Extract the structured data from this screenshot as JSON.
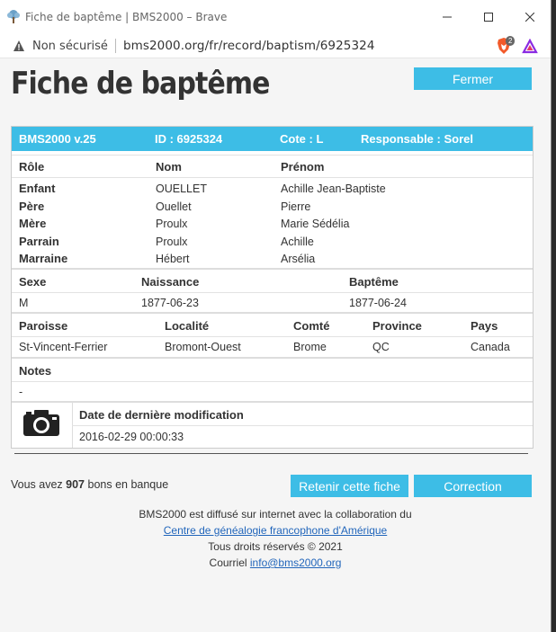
{
  "window": {
    "title": "Fiche de baptême | BMS2000 – Brave",
    "security_label": "Non sécurisé",
    "url": "bms2000.org/fr/record/baptism/6925324",
    "shield_count": "2"
  },
  "page": {
    "heading": "Fiche de baptême",
    "close_label": "Fermer"
  },
  "record": {
    "header": {
      "version": "BMS2000 v.25",
      "id": "ID : 6925324",
      "cote": "Cote : L",
      "responsable": "Responsable : Sorel"
    },
    "people_headers": [
      "Rôle",
      "Nom",
      "Prénom"
    ],
    "people": [
      {
        "role": "Enfant",
        "nom": "OUELLET",
        "prenom": "Achille Jean-Baptiste"
      },
      {
        "role": "Père",
        "nom": "Ouellet",
        "prenom": "Pierre"
      },
      {
        "role": "Mère",
        "nom": "Proulx",
        "prenom": "Marie Sédélia"
      },
      {
        "role": "Parrain",
        "nom": "Proulx",
        "prenom": "Achille"
      },
      {
        "role": "Marraine",
        "nom": "Hébert",
        "prenom": "Arsélia"
      }
    ],
    "vital_headers": [
      "Sexe",
      "Naissance",
      "Baptême"
    ],
    "vital": {
      "sexe": "M",
      "naissance": "1877-06-23",
      "bapteme": "1877-06-24"
    },
    "place_headers": [
      "Paroisse",
      "Localité",
      "Comté",
      "Province",
      "Pays"
    ],
    "place": {
      "paroisse": "St-Vincent-Ferrier",
      "localite": "Bromont-Ouest",
      "comte": "Brome",
      "province": "QC",
      "pays": "Canada"
    },
    "notes_label": "Notes",
    "notes_value": "-",
    "modified_label": "Date de dernière modification",
    "modified_value": "2016-02-29 00:00:33"
  },
  "bank": {
    "prefix": "Vous avez ",
    "count": "907",
    "suffix": " bons en banque"
  },
  "actions": {
    "retain_label": "Retenir cette fiche",
    "correction_label": "Correction"
  },
  "footer": {
    "line1": "BMS2000 est diffusé sur internet avec la collaboration du",
    "link": "Centre de généalogie francophone d'Amérique",
    "rights": "Tous droits réservés © 2021",
    "courriel_label": "Courriel ",
    "email": "info@bms2000.org"
  },
  "colors": {
    "accent": "#3dbde6",
    "link": "#2266bb"
  }
}
